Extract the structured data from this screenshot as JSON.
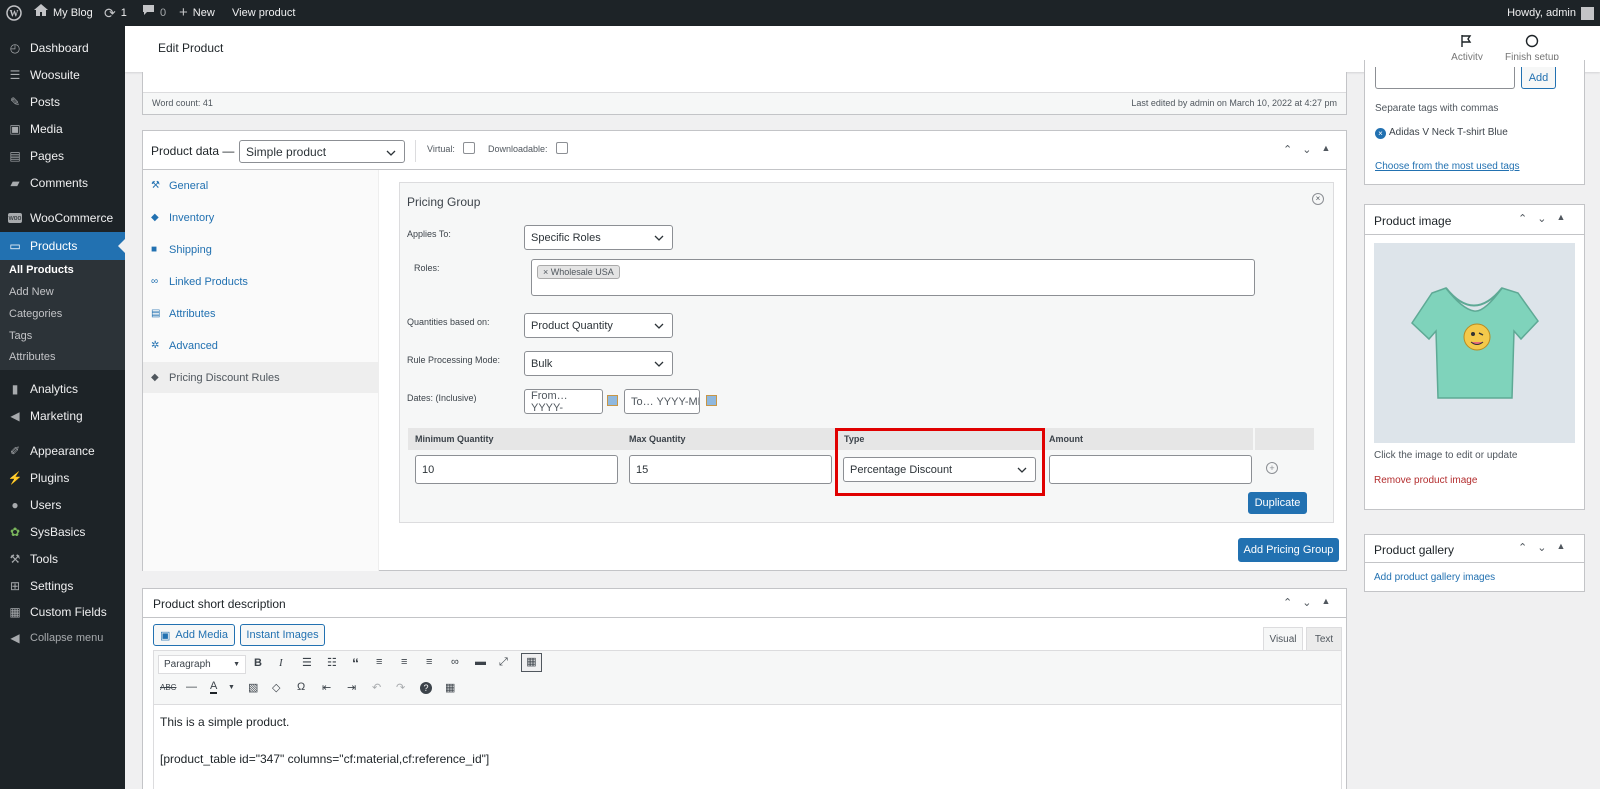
{
  "adminbar": {
    "site_name": "My Blog",
    "updates_count": "1",
    "comments_count": "0",
    "new_label": "New",
    "view_product_label": "View product",
    "howdy": "Howdy, admin"
  },
  "sidebar": {
    "items": [
      {
        "label": "Dashboard",
        "icon": "dashboard-icon"
      },
      {
        "label": "Woosuite",
        "icon": "woosuite-icon"
      },
      {
        "label": "Posts",
        "icon": "pin-icon"
      },
      {
        "label": "Media",
        "icon": "media-icon"
      },
      {
        "label": "Pages",
        "icon": "pages-icon"
      },
      {
        "label": "Comments",
        "icon": "comment-icon"
      },
      {
        "label": "WooCommerce",
        "icon": "woocommerce-icon"
      },
      {
        "label": "Products",
        "icon": "products-icon"
      },
      {
        "label": "Analytics",
        "icon": "analytics-icon"
      },
      {
        "label": "Marketing",
        "icon": "megaphone-icon"
      },
      {
        "label": "Appearance",
        "icon": "brush-icon"
      },
      {
        "label": "Plugins",
        "icon": "plugin-icon"
      },
      {
        "label": "Users",
        "icon": "user-icon"
      },
      {
        "label": "SysBasics",
        "icon": "sysbasics-icon"
      },
      {
        "label": "Tools",
        "icon": "wrench-icon"
      },
      {
        "label": "Settings",
        "icon": "settings-icon"
      },
      {
        "label": "Custom Fields",
        "icon": "custom-fields-icon"
      },
      {
        "label": "Collapse menu",
        "icon": "collapse-icon"
      }
    ],
    "submenu": [
      "All Products",
      "Add New",
      "Categories",
      "Tags",
      "Attributes"
    ]
  },
  "header": {
    "title": "Edit Product",
    "activity_label": "Activity",
    "finish_setup_label": "Finish setup"
  },
  "editor_status": {
    "word_count": "Word count: 41",
    "last_edited": "Last edited by admin on March 10, 2022 at 4:27 pm"
  },
  "product_data": {
    "label": "Product data —",
    "type_value": "Simple product",
    "virtual_label": "Virtual:",
    "downloadable_label": "Downloadable:",
    "tabs": [
      {
        "label": "General",
        "icon": "wrench-icon"
      },
      {
        "label": "Inventory",
        "icon": "tag-icon"
      },
      {
        "label": "Shipping",
        "icon": "truck-icon"
      },
      {
        "label": "Linked Products",
        "icon": "link-icon"
      },
      {
        "label": "Attributes",
        "icon": "table-icon"
      },
      {
        "label": "Advanced",
        "icon": "gear-icon"
      },
      {
        "label": "Pricing Discount Rules",
        "icon": "tag-icon"
      }
    ]
  },
  "pricing_group": {
    "title": "Pricing Group",
    "applies_to_label": "Applies To:",
    "applies_to_value": "Specific Roles",
    "roles_label": "Roles:",
    "role_chip": "× Wholesale USA",
    "quantities_label": "Quantities based on:",
    "quantities_value": "Product Quantity",
    "rule_mode_label": "Rule Processing Mode:",
    "rule_mode_value": "Bulk",
    "dates_label": "Dates: (Inclusive)",
    "date_from_placeholder": "From… YYYY-",
    "date_to_placeholder": "To… YYYY-MM",
    "table_headers": [
      "Minimum Quantity",
      "Max Quantity",
      "Type",
      "Amount"
    ],
    "row": {
      "min": "10",
      "max": "15",
      "type": "Percentage Discount",
      "amount": ""
    },
    "duplicate_label": "Duplicate",
    "add_group_label": "Add Pricing Group"
  },
  "short_description": {
    "title": "Product short description",
    "add_media_label": "Add Media",
    "instant_images_label": "Instant Images",
    "visual_tab": "Visual",
    "text_tab": "Text",
    "format_value": "Paragraph",
    "content_line1": "This is a simple product.",
    "content_line2": "[product_table id=\"347\" columns=\"cf:material,cf:reference_id\"]"
  },
  "tags_box": {
    "add_label": "Add",
    "hint": "Separate tags with commas",
    "tag": "Adidas V Neck T-shirt Blue",
    "most_used_link": "Choose from the most used tags"
  },
  "product_image": {
    "title": "Product image",
    "hint": "Click the image to edit or update",
    "remove_link": "Remove product image"
  },
  "product_gallery": {
    "title": "Product gallery",
    "add_link": "Add product gallery images"
  },
  "colors": {
    "accent": "#2271b1",
    "sidebar": "#1d2327",
    "highlight": "#e00000"
  }
}
